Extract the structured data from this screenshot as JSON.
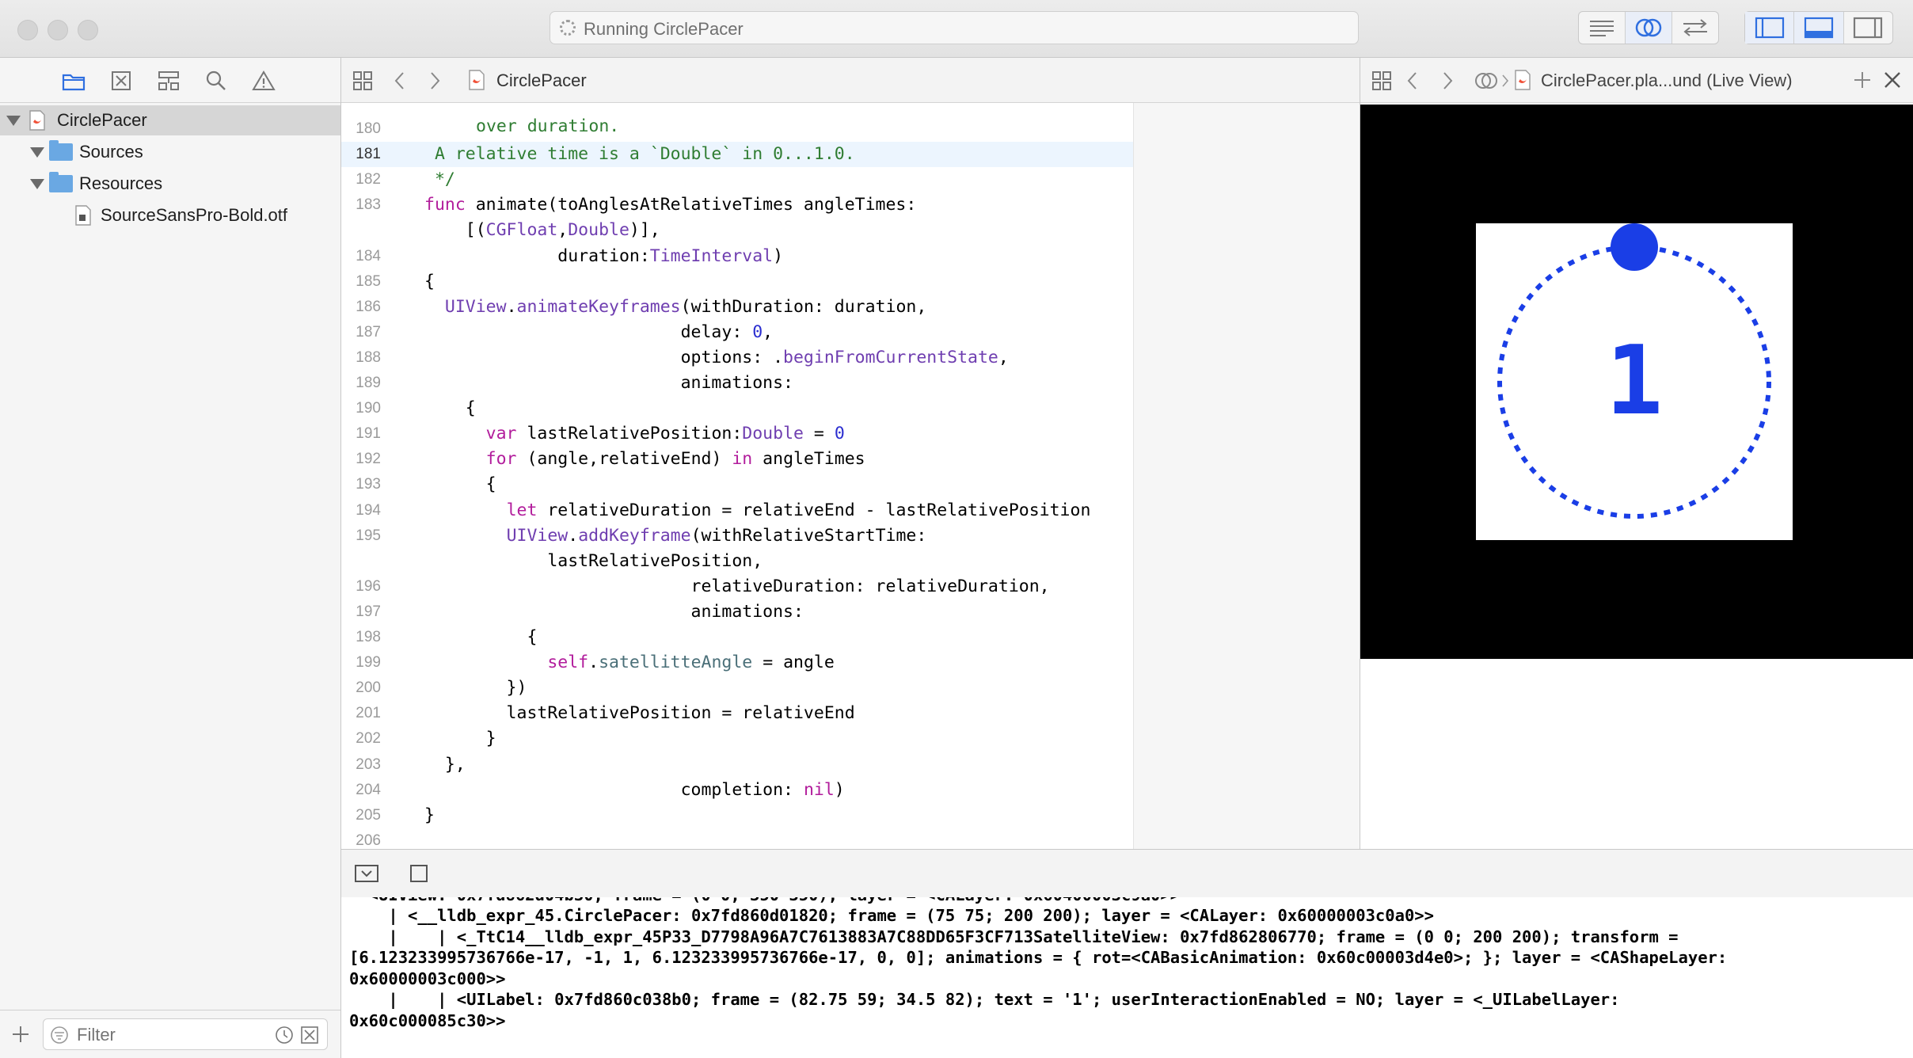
{
  "window": {
    "activity_text": "Running CirclePacer"
  },
  "navigator": {
    "tree": [
      {
        "label": "CirclePacer",
        "selected": true
      },
      {
        "label": "Sources"
      },
      {
        "label": "Resources"
      },
      {
        "label": "SourceSansPro-Bold.otf"
      }
    ],
    "filter_placeholder": "Filter"
  },
  "editor": {
    "jump_file": "CirclePacer",
    "top_partial": "over duration.",
    "current_line": "181",
    "lines": [
      {
        "n": "180",
        "code": ""
      },
      {
        "n": "181",
        "code": " A relative time is a `Double` in 0...1.0."
      },
      {
        "n": "182",
        "code": " */"
      },
      {
        "n": "183",
        "code": "func animate(toAnglesAtRelativeTimes angleTimes:"
      },
      {
        "n": "",
        "code": "    [(CGFloat,Double)],"
      },
      {
        "n": "184",
        "code": "             duration:TimeInterval)"
      },
      {
        "n": "185",
        "code": "{"
      },
      {
        "n": "186",
        "code": "  UIView.animateKeyframes(withDuration: duration,"
      },
      {
        "n": "187",
        "code": "                         delay: 0,"
      },
      {
        "n": "188",
        "code": "                         options: .beginFromCurrentState,"
      },
      {
        "n": "189",
        "code": "                         animations:"
      },
      {
        "n": "190",
        "code": "    {"
      },
      {
        "n": "191",
        "code": "      var lastRelativePosition:Double = 0"
      },
      {
        "n": "192",
        "code": "      for (angle,relativeEnd) in angleTimes"
      },
      {
        "n": "193",
        "code": "      {"
      },
      {
        "n": "194",
        "code": "        let relativeDuration = relativeEnd - lastRelativePosition"
      },
      {
        "n": "195",
        "code": "        UIView.addKeyframe(withRelativeStartTime:"
      },
      {
        "n": "",
        "code": "            lastRelativePosition,"
      },
      {
        "n": "196",
        "code": "                          relativeDuration: relativeDuration,"
      },
      {
        "n": "197",
        "code": "                          animations:"
      },
      {
        "n": "198",
        "code": "          {"
      },
      {
        "n": "199",
        "code": "            self.satellitteAngle = angle"
      },
      {
        "n": "200",
        "code": "        })"
      },
      {
        "n": "201",
        "code": "        lastRelativePosition = relativeEnd"
      },
      {
        "n": "202",
        "code": "      }"
      },
      {
        "n": "203",
        "code": "  },"
      },
      {
        "n": "204",
        "code": "                         completion: nil)"
      },
      {
        "n": "205",
        "code": "}"
      },
      {
        "n": "206",
        "code": ""
      }
    ]
  },
  "assistant": {
    "jump_title": "CirclePacer.pla...und (Live View)",
    "counter_label": "1"
  },
  "console": {
    "lines": [
      "    | <__lldb_expr_45.CirclePacer: 0x7fd860d01820; frame = (75 75; 200 200); layer = <CALayer: 0x60000003c0a0>>",
      "    |    | <_TtC14__lldb_expr_45P33_D7798A96A7C7613883A7C88DD65F3CF713SatelliteView: 0x7fd862806770; frame = (0 0; 200 200); transform =",
      "[6.123233995736766e-17, -1, 1, 6.123233995736766e-17, 0, 0]; animations = { rot=<CABasicAnimation: 0x60c00003d4e0>; }; layer = <CAShapeLayer:",
      "0x60000003c000>>",
      "    |    | <UILabel: 0x7fd860c038b0; frame = (82.75 59; 34.5 82); text = '1'; userInteractionEnabled = NO; layer = <_UILabelLayer:",
      "0x60c000085c30>>"
    ]
  },
  "colors": {
    "accent": "#1a5bff",
    "keyword": "#b21d9c",
    "type": "#6f3eb0",
    "number": "#2b2ed0",
    "comment": "#2f7d32"
  }
}
